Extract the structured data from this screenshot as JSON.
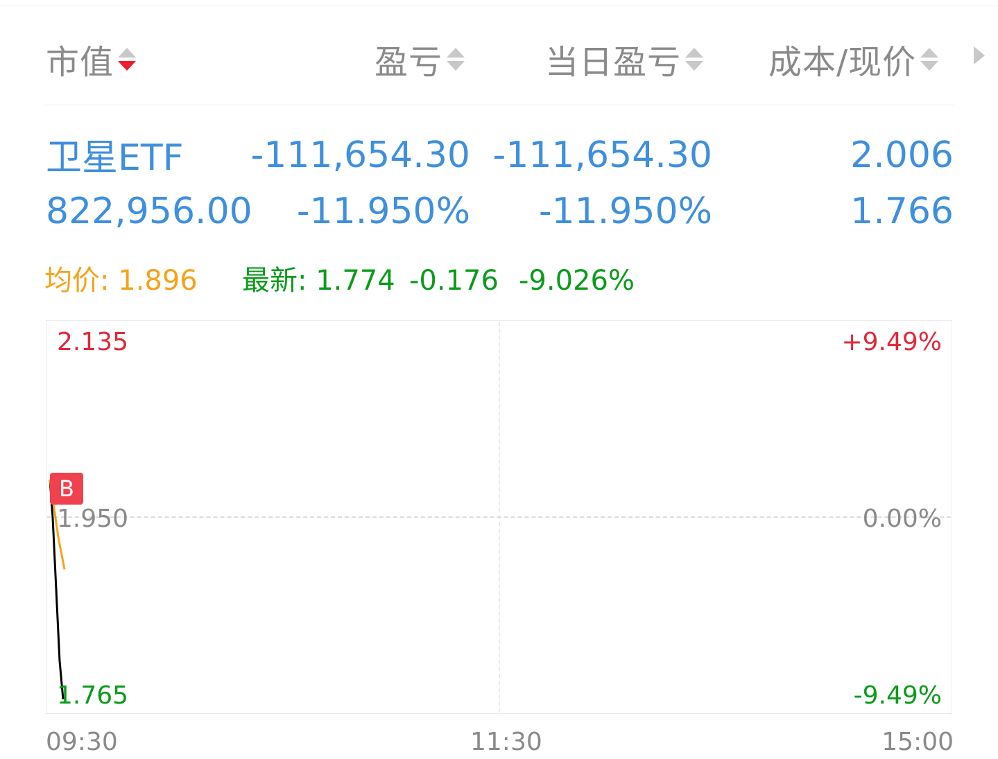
{
  "header": {
    "col1": "市值",
    "col2": "盈亏",
    "col3": "当日盈亏",
    "col4": "成本/现价"
  },
  "holding": {
    "name": "卫星ETF",
    "market_value": "822,956.00",
    "profit": "-111,654.30",
    "profit_pct": "-11.950%",
    "day_profit": "-111,654.30",
    "day_profit_pct": "-11.950%",
    "cost": "2.006",
    "price": "1.766"
  },
  "info": {
    "avg_label": "均价:",
    "avg_value": "1.896",
    "latest_label": "最新:",
    "latest_value": "1.774",
    "change": "-0.176",
    "change_pct": "-9.026%"
  },
  "chart_data": {
    "type": "line",
    "y_labels": {
      "high": "2.135",
      "mid": "1.950",
      "low": "1.765"
    },
    "pct_labels": {
      "high": "+9.49%",
      "mid": "0.00%",
      "low": "-9.49%"
    },
    "x_labels": [
      "09:30",
      "11:30",
      "15:00"
    ],
    "ylim": [
      1.765,
      2.135
    ],
    "series": [
      {
        "values": [
          1.99,
          1.95,
          1.8,
          1.76
        ]
      },
      {
        "values": [
          1.99,
          1.93,
          1.896
        ]
      }
    ],
    "marker_label": "B",
    "colors": {
      "price": "#000000",
      "avg": "#f5a31a",
      "marker": "#f0414e"
    }
  },
  "colors": {
    "blue": "#3e8fdd",
    "red": "#e0283a",
    "green": "#0a9b1a",
    "orange": "#f5a31a"
  }
}
